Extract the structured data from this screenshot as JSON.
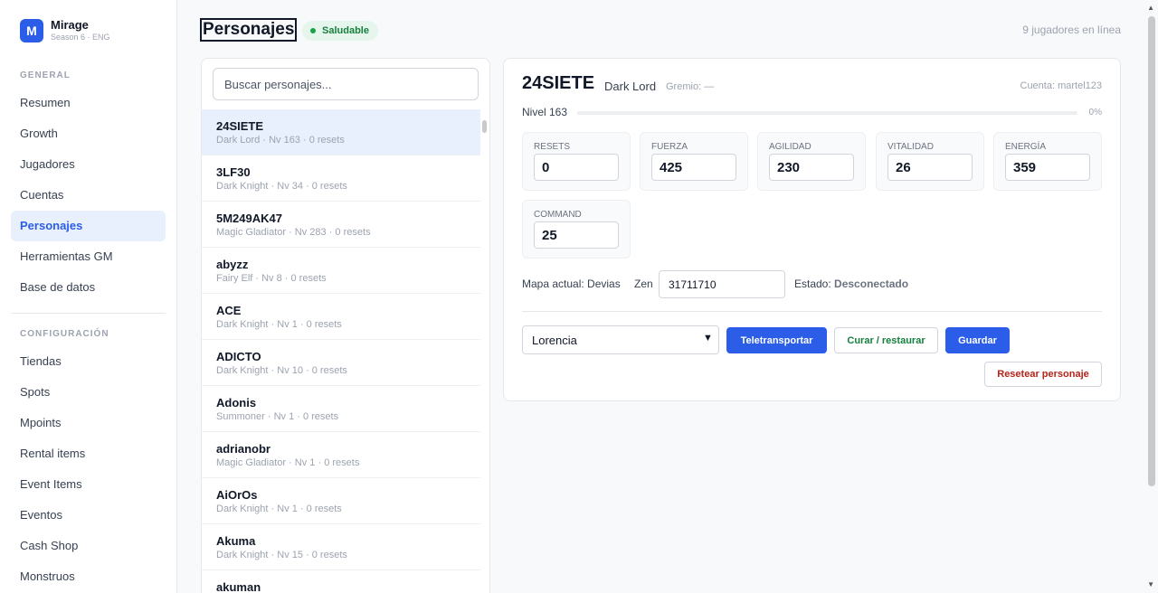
{
  "brand": {
    "logo_letter": "M",
    "name": "Mirage",
    "subtitle": "Season 6 · ENG"
  },
  "sidebar": {
    "general_label": "GENERAL",
    "general_items": [
      {
        "label": "Resumen"
      },
      {
        "label": "Growth"
      },
      {
        "label": "Jugadores"
      },
      {
        "label": "Cuentas"
      },
      {
        "label": "Personajes",
        "active": true
      },
      {
        "label": "Herramientas GM"
      },
      {
        "label": "Base de datos"
      }
    ],
    "config_label": "CONFIGURACIÓN",
    "config_items": [
      {
        "label": "Tiendas"
      },
      {
        "label": "Spots"
      },
      {
        "label": "Mpoints"
      },
      {
        "label": "Rental items"
      },
      {
        "label": "Event Items"
      },
      {
        "label": "Eventos"
      },
      {
        "label": "Cash Shop"
      },
      {
        "label": "Monstruos"
      }
    ]
  },
  "header": {
    "title": "Personajes",
    "status": "Saludable",
    "status_color": "#16a34a",
    "online": "9 jugadores en línea"
  },
  "search": {
    "placeholder": "Buscar personajes..."
  },
  "characters": [
    {
      "name": "24SIETE",
      "meta": "Dark Lord · Nv 163 · 0 resets",
      "selected": true
    },
    {
      "name": "3LF30",
      "meta": "Dark Knight · Nv 34 · 0 resets"
    },
    {
      "name": "5M249AK47",
      "meta": "Magic Gladiator · Nv 283 · 0 resets"
    },
    {
      "name": "abyzz",
      "meta": "Fairy Elf · Nv 8 · 0 resets"
    },
    {
      "name": "ACE",
      "meta": "Dark Knight · Nv 1 · 0 resets"
    },
    {
      "name": "ADICTO",
      "meta": "Dark Knight · Nv 10 · 0 resets"
    },
    {
      "name": "Adonis",
      "meta": "Summoner · Nv 1 · 0 resets"
    },
    {
      "name": "adrianobr",
      "meta": "Magic Gladiator · Nv 1 · 0 resets"
    },
    {
      "name": "AiOrOs",
      "meta": "Dark Knight · Nv 1 · 0 resets"
    },
    {
      "name": "Akuma",
      "meta": "Dark Knight · Nv 15 · 0 resets"
    },
    {
      "name": "akuman",
      "meta": ""
    }
  ],
  "detail": {
    "name": "24SIETE",
    "class": "Dark Lord",
    "guild": "Gremio: —",
    "account": "Cuenta: martel123",
    "level_label": "Nivel 163",
    "level_progress_pct": "0%",
    "level_progress": 0,
    "stats": [
      {
        "label": "Resets",
        "value": "0"
      },
      {
        "label": "Fuerza",
        "value": "425"
      },
      {
        "label": "Agilidad",
        "value": "230"
      },
      {
        "label": "Vitalidad",
        "value": "26"
      },
      {
        "label": "Energía",
        "value": "359"
      },
      {
        "label": "Command",
        "value": "25"
      }
    ],
    "location": "Mapa actual: Devias",
    "zen_label": "Zen",
    "zen_value": "31711710",
    "estado_label": "Estado:",
    "estado_value": "Desconectado",
    "map_select": "Lorencia",
    "btn_teleport": "Teletransportar",
    "btn_heal": "Curar / restaurar",
    "btn_save": "Guardar",
    "btn_reset": "Resetear personaje"
  }
}
